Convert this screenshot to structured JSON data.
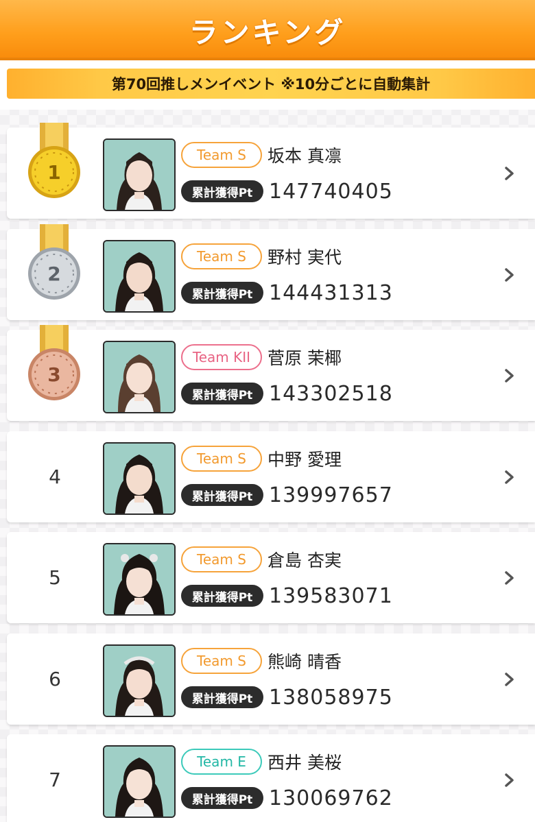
{
  "header": {
    "title": "ランキング"
  },
  "event": {
    "label": "第70回推しメンイベント ※10分ごとに自動集計"
  },
  "colors": {
    "accent": "#ff9f1c",
    "gold": "#f3c21b",
    "silver": "#c8ccd2",
    "bronze": "#e2a58b"
  },
  "ranking": [
    {
      "rank": "1",
      "team": "Team S",
      "name": "坂本 真凛",
      "pt_label": "累計獲得Pt",
      "points": "147740405",
      "medal": "gold"
    },
    {
      "rank": "2",
      "team": "Team S",
      "name": "野村 実代",
      "pt_label": "累計獲得Pt",
      "points": "144431313",
      "medal": "silver"
    },
    {
      "rank": "3",
      "team": "Team KII",
      "name": "菅原 茉椰",
      "pt_label": "累計獲得Pt",
      "points": "143302518",
      "medal": "bronze"
    },
    {
      "rank": "4",
      "team": "Team S",
      "name": "中野 愛理",
      "pt_label": "累計獲得Pt",
      "points": "139997657",
      "medal": ""
    },
    {
      "rank": "5",
      "team": "Team S",
      "name": "倉島 杏実",
      "pt_label": "累計獲得Pt",
      "points": "139583071",
      "medal": ""
    },
    {
      "rank": "6",
      "team": "Team S",
      "name": "熊崎 晴香",
      "pt_label": "累計獲得Pt",
      "points": "138058975",
      "medal": ""
    },
    {
      "rank": "7",
      "team": "Team E",
      "name": "西井 美桜",
      "pt_label": "累計獲得Pt",
      "points": "130069762",
      "medal": ""
    }
  ]
}
